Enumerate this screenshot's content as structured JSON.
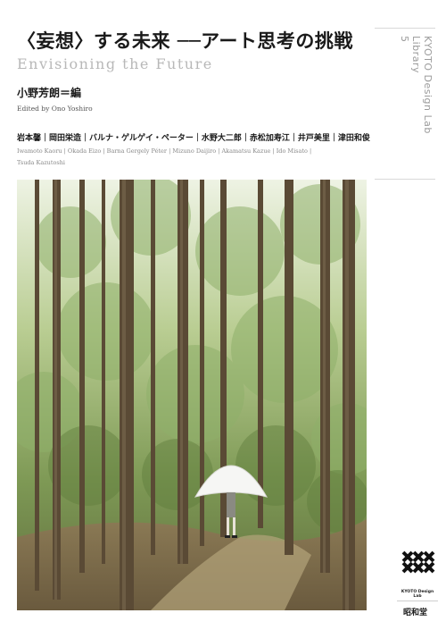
{
  "title": "〈妄想〉する未来 ──アート思考の挑戦",
  "subtitle_en": "Envisioning the Future",
  "editor_jp": "小野芳朗＝編",
  "editor_en": "Edited by Ono Yoshiro",
  "authors_jp": "岩本馨｜岡田栄造｜バルナ・ゲルゲイ・ペーター｜水野大二郎｜赤松加寿江｜井戸美里｜津田和俊",
  "authors_en": "Iwamoto Kaoru | Okada Eizo | Barna Gergely Péter | Mizuno Daijiro | Akamatsu Kazue | Ido Misato | Tsuda Kazutoshi",
  "series": {
    "line1": "KYOTO Design Lab",
    "line2": "Library",
    "line3": "5"
  },
  "logo_text": "KYOTO Design Lab",
  "publisher": "昭和堂",
  "colors": {
    "background": "#ffffff",
    "title": "#1a1a1a",
    "subtitle": "#b8b8b8",
    "series": "#9a9a9a",
    "foliage": "#7f9a55",
    "trunk": "#5a4a35"
  }
}
